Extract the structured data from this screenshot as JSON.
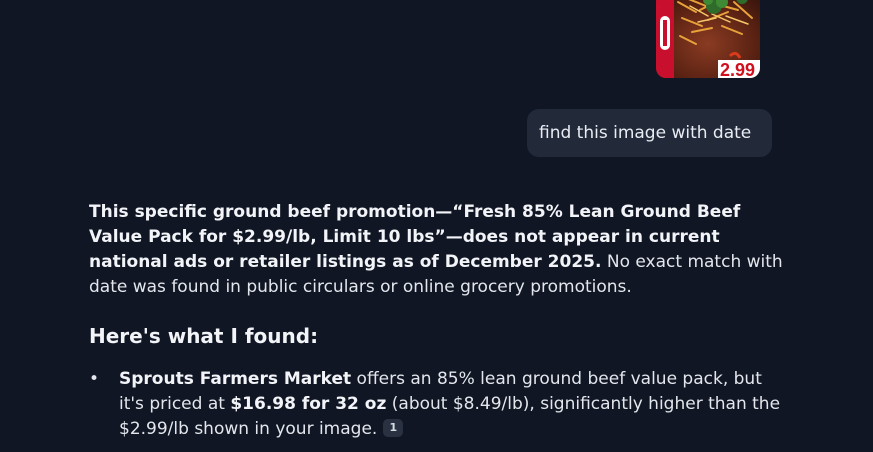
{
  "user_message": "find this image with date",
  "thumbnail": {
    "price_fragment": "2.99"
  },
  "response": {
    "intro_bold": "This specific ground beef promotion—“Fresh 85% Lean Ground Beef Value Pack for $2.99/lb, Limit 10 lbs”—does not appear in current national ads or retailer listings as of December 2025.",
    "intro_rest": " No exact match with date was found in public circulars or online grocery promotions.",
    "heading": "Here's what I found:",
    "bullets": [
      {
        "marker": "•",
        "bold1": "Sprouts Farmers Market",
        "text1": " offers an 85% lean ground beef value pack, but it's priced at ",
        "bold2": "$16.98 for 32 oz",
        "text2": " (about $8.49/lb), significantly higher than the $2.99/lb shown in your image.",
        "citation": "1"
      }
    ]
  }
}
